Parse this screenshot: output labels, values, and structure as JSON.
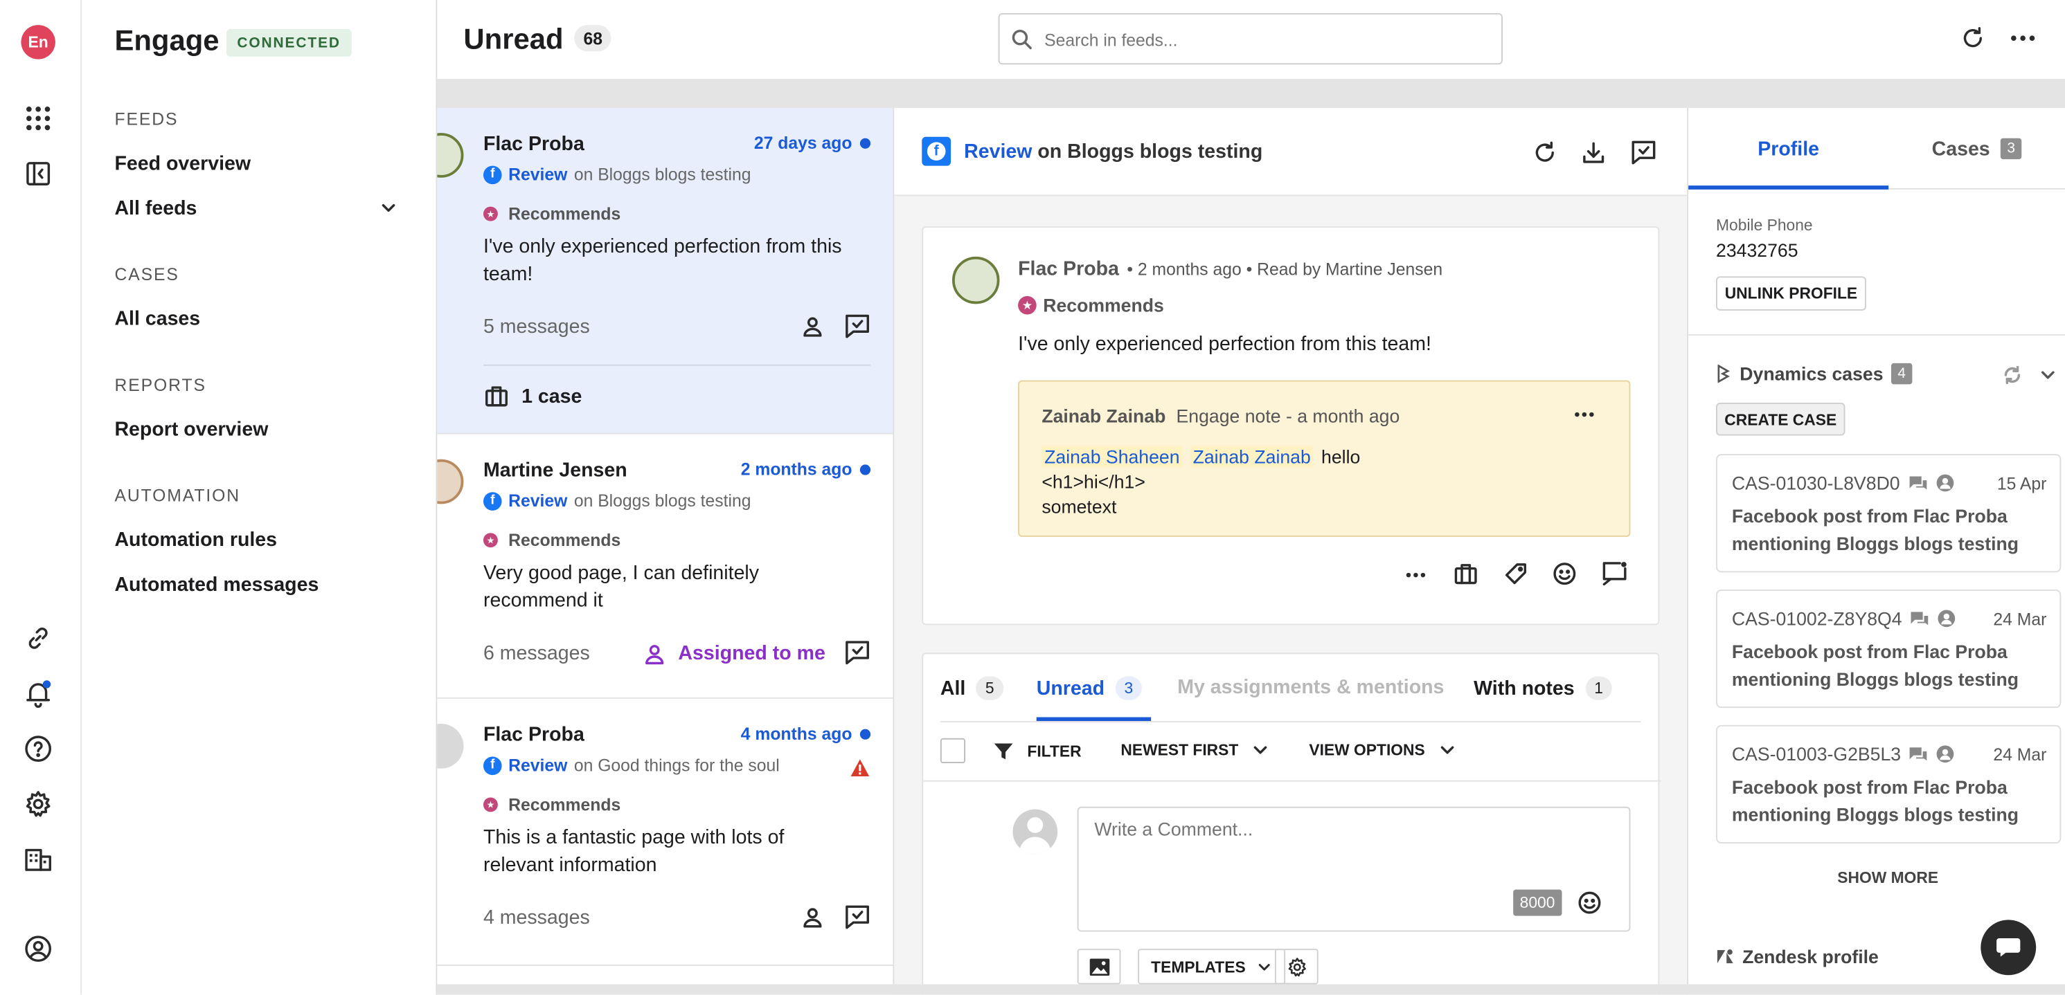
{
  "app": {
    "logo": "En",
    "name": "Engage",
    "status": "CONNECTED"
  },
  "sidebar": {
    "sections": [
      {
        "title": "FEEDS",
        "items": [
          "Feed overview",
          "All feeds"
        ]
      },
      {
        "title": "CASES",
        "items": [
          "All cases"
        ]
      },
      {
        "title": "REPORTS",
        "items": [
          "Report overview"
        ]
      },
      {
        "title": "AUTOMATION",
        "items": [
          "Automation rules",
          "Automated messages"
        ]
      }
    ]
  },
  "header": {
    "title": "Unread",
    "count": "68",
    "search_placeholder": "Search in feeds..."
  },
  "feed": {
    "items": [
      {
        "author": "Flac Proba",
        "time": "27 days ago",
        "source_link": "Review",
        "source_text": "on Bloggs blogs testing",
        "rating": "Recommends",
        "text": "I've only experienced perfection from this team!",
        "messages": "5 messages",
        "cases": "1 case"
      },
      {
        "author": "Martine Jensen",
        "time": "2 months ago",
        "source_link": "Review",
        "source_text": "on Bloggs blogs testing",
        "rating": "Recommends",
        "text": "Very good page, I can definitely recommend it",
        "messages": "6 messages",
        "assigned": "Assigned to me"
      },
      {
        "author": "Flac Proba",
        "time": "4 months ago",
        "source_link": "Review",
        "source_text": "on Good things for the soul",
        "rating": "Recommends",
        "text": "This is a fantastic page with lots of relevant information",
        "messages": "4 messages"
      }
    ]
  },
  "conversation": {
    "header_link": "Review",
    "header_text": "on Bloggs blogs testing",
    "post": {
      "author": "Flac Proba",
      "meta": "• 2 months ago • Read by Martine Jensen",
      "rating": "Recommends",
      "text": "I've only experienced perfection from this team!",
      "note": {
        "author": "Zainab Zainab",
        "meta": "Engage note - a month ago",
        "mention1": "Zainab Shaheen",
        "mention2": "Zainab Zainab",
        "line1_rest": "hello",
        "line2": "<h1>hi</h1>",
        "line3": "sometext"
      }
    },
    "tabs": [
      {
        "label": "All",
        "count": "5"
      },
      {
        "label": "Unread",
        "count": "3"
      },
      {
        "label": "My assignments & mentions",
        "count": ""
      },
      {
        "label": "With notes",
        "count": "1"
      }
    ],
    "filter": {
      "filter_label": "FILTER",
      "sort_label": "NEWEST FIRST",
      "view_label": "VIEW OPTIONS"
    },
    "comment": {
      "placeholder": "Write a Comment...",
      "char_limit": "8000",
      "templates_label": "TEMPLATES"
    }
  },
  "profile": {
    "tabs": [
      {
        "label": "Profile"
      },
      {
        "label": "Cases",
        "count": "3"
      }
    ],
    "phone_label": "Mobile Phone",
    "phone_value": "23432765",
    "unlink_label": "UNLINK PROFILE",
    "dynamics_title": "Dynamics cases",
    "dynamics_count": "4",
    "create_case_label": "CREATE CASE",
    "cases": [
      {
        "id": "CAS-01030-L8V8D0",
        "date": "15 Apr",
        "title": "Facebook post from Flac Proba mentioning Bloggs blogs testing"
      },
      {
        "id": "CAS-01002-Z8Y8Q4",
        "date": "24 Mar",
        "title": "Facebook post from Flac Proba mentioning Bloggs blogs testing"
      },
      {
        "id": "CAS-01003-G2B5L3",
        "date": "24 Mar",
        "title": "Facebook post from Flac Proba mentioning Bloggs blogs testing"
      }
    ],
    "show_more_label": "SHOW MORE",
    "zendesk_label": "Zendesk profile"
  },
  "colors": {
    "accent": "#1a5ad6",
    "note_bg": "#fdf3d6",
    "status_bg": "#e3f1e6",
    "assigned": "#8b2fc9",
    "logo_bg": "#e0445c"
  },
  "icons": [
    "apps-icon",
    "sidebar-toggle-icon",
    "link-icon",
    "bell-icon",
    "help-icon",
    "gear-icon",
    "buildings-icon",
    "user-circle-icon",
    "search-icon",
    "refresh-icon",
    "more-icon",
    "download-icon",
    "chat-check-icon",
    "briefcase-icon",
    "tag-icon",
    "smiley-icon",
    "filter-icon",
    "chevron-down-icon",
    "image-icon",
    "chat-bubble-icon",
    "warning-icon"
  ]
}
